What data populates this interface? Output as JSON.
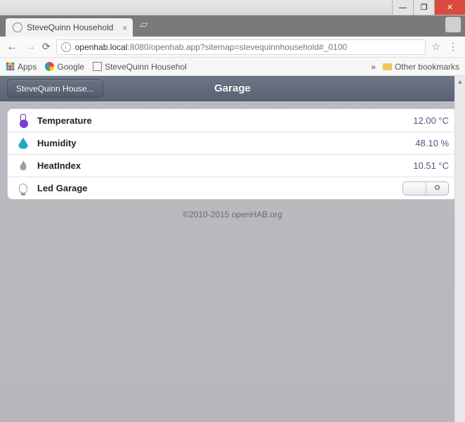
{
  "window": {
    "tab_title": "SteveQuinn Household",
    "minimize": "—",
    "maximize": "❐",
    "close": "✕"
  },
  "browser": {
    "url_host": "openhab.local",
    "url_rest": ":8080/openhab.app?sitemap=stevequinnhousehold#_0100",
    "apps_label": "Apps",
    "bookmarks": [
      {
        "label": "Google"
      },
      {
        "label": "SteveQuinn Househol"
      }
    ],
    "more_chevron": "»",
    "other_bookmarks": "Other bookmarks"
  },
  "page": {
    "back_button": "SteveQuinn House...",
    "title": "Garage",
    "rows": [
      {
        "label": "Temperature",
        "value": "12.00 °C",
        "icon": "thermometer"
      },
      {
        "label": "Humidity",
        "value": "48.10 %",
        "icon": "droplet"
      },
      {
        "label": "HeatIndex",
        "value": "10.51 °C",
        "icon": "flame"
      },
      {
        "label": "Led Garage",
        "icon": "bulb",
        "switch_on": "O",
        "switch_off": ""
      }
    ],
    "footer": "©2010-2015 openHAB.org"
  }
}
